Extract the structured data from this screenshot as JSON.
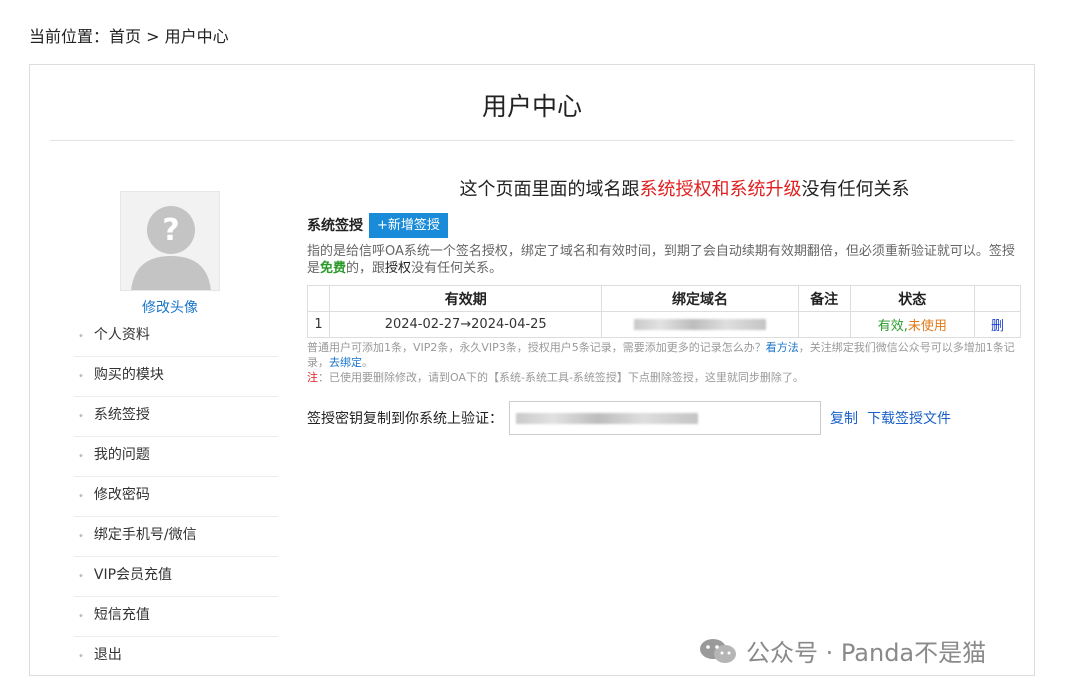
{
  "breadcrumb": {
    "prefix": "当前位置：",
    "home": "首页",
    "sep": " > ",
    "current": "用户中心"
  },
  "page_title": "用户中心",
  "avatar": {
    "change_label": "修改头像"
  },
  "sidebar": {
    "items": [
      {
        "label": "个人资料"
      },
      {
        "label": "购买的模块"
      },
      {
        "label": "系统签授"
      },
      {
        "label": "我的问题"
      },
      {
        "label": "修改密码"
      },
      {
        "label": "绑定手机号/微信"
      },
      {
        "label": "VIP会员充值"
      },
      {
        "label": "短信充值"
      },
      {
        "label": "退出"
      }
    ]
  },
  "notice": {
    "part1": "这个页面里面的域名跟",
    "highlight": "系统授权和系统升级",
    "part2": "没有任何关系"
  },
  "section": {
    "title": "系统签授",
    "add_button": "+新增签授"
  },
  "desc": {
    "part1": "指的是给信呼OA系统一个签名授权，绑定了域名和有效时间，到期了会自动续期有效期翻倍，但必须重新验证就可以。签授是",
    "free": "免费",
    "part2": "的，跟",
    "auth": "授权",
    "part3": "没有任何关系。"
  },
  "table": {
    "headers": [
      "",
      "有效期",
      "绑定域名",
      "备注",
      "状态",
      ""
    ],
    "rows": [
      {
        "index": "1",
        "validity": "2024-02-27→2024-04-25",
        "domain": "",
        "remark": "",
        "status_valid": "有效",
        "status_sep": ",",
        "status_unused": "未使用",
        "action": "删"
      }
    ]
  },
  "note1": {
    "text": "普通用户可添加1条，VIP2条，永久VIP3条，授权用户5条记录，需要添加更多的记录怎么办？",
    "link": "看方法",
    "text2": "，关注绑定我们微信公众号可以多增加1条记录，",
    "link2": "去绑定",
    "end": "。"
  },
  "note2": {
    "label": "注",
    "text": "：已使用要删除修改，请到OA下的【系统-系统工具-系统签授】下点删除签授，这里就同步删除了。"
  },
  "key": {
    "label": "签授密钥复制到你系统上验证：",
    "value": "",
    "copy": "复制",
    "download": "下载签授文件"
  },
  "watermark": {
    "text": "公众号 · Panda不是猫"
  },
  "colors": {
    "accent": "#1a8bd8",
    "red": "#e02020",
    "green": "#2a9a2a",
    "orange": "#e07a1a"
  }
}
